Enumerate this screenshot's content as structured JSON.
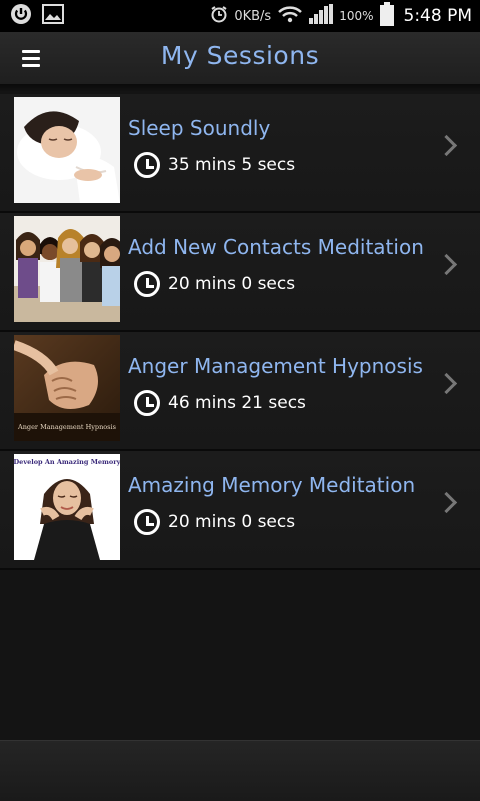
{
  "status_bar": {
    "data_rate": "0KB/s",
    "battery": "100%",
    "time": "5:48 PM"
  },
  "header": {
    "title": "My Sessions"
  },
  "sessions": [
    {
      "title": "Sleep Soundly",
      "duration": "35 mins 5 secs"
    },
    {
      "title": "Add New Contacts Meditation",
      "duration": "20 mins 0 secs"
    },
    {
      "title": "Anger Management Hypnosis",
      "duration": "46 mins 21 secs"
    },
    {
      "title": "Amazing Memory Meditation",
      "duration": "20 mins 0 secs"
    }
  ],
  "thumbnail_captions": {
    "anger": "Anger Management Hypnosis",
    "memory": "Develop An Amazing Memory"
  },
  "colors": {
    "accent": "#8fb6ef",
    "background": "#141414"
  }
}
